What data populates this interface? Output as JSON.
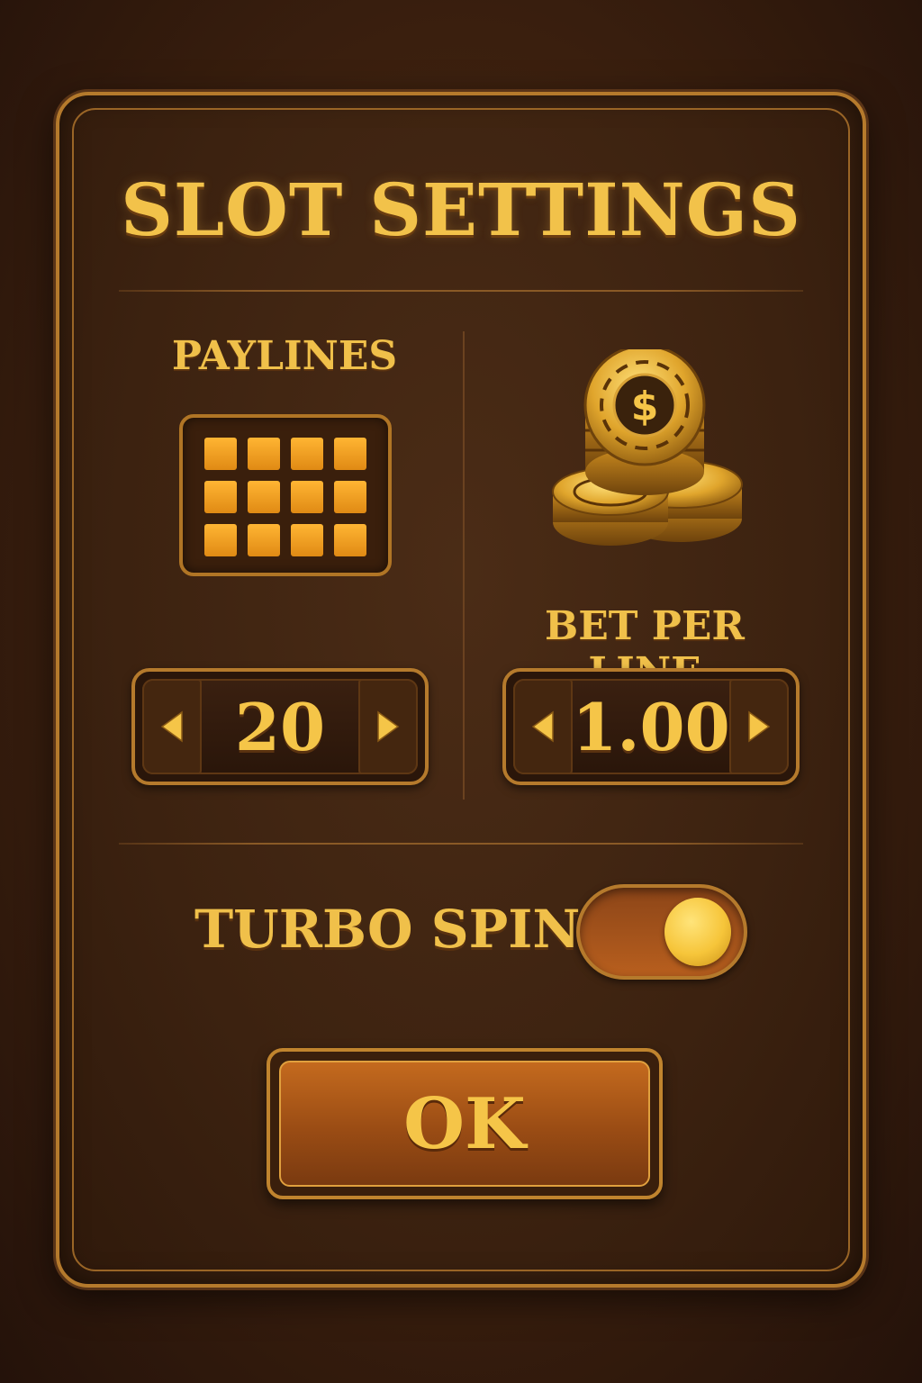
{
  "title": "SLOT SETTINGS",
  "paylines": {
    "label": "PAYLINES",
    "icon": "paylines-grid-icon",
    "value": "20"
  },
  "bet": {
    "label": "BET PER LINE",
    "icon": "casino-chips-icon",
    "value": "1.00"
  },
  "turbo_spin": {
    "label": "TURBO SPIN",
    "enabled": true
  },
  "ok_button": {
    "label": "OK"
  },
  "colors": {
    "gold_text": "#f2c24a",
    "panel_border": "#b57a2c",
    "background": "#3a1f0e",
    "grid_cell": "#f0a020",
    "toggle_track": "#b85f1e"
  }
}
